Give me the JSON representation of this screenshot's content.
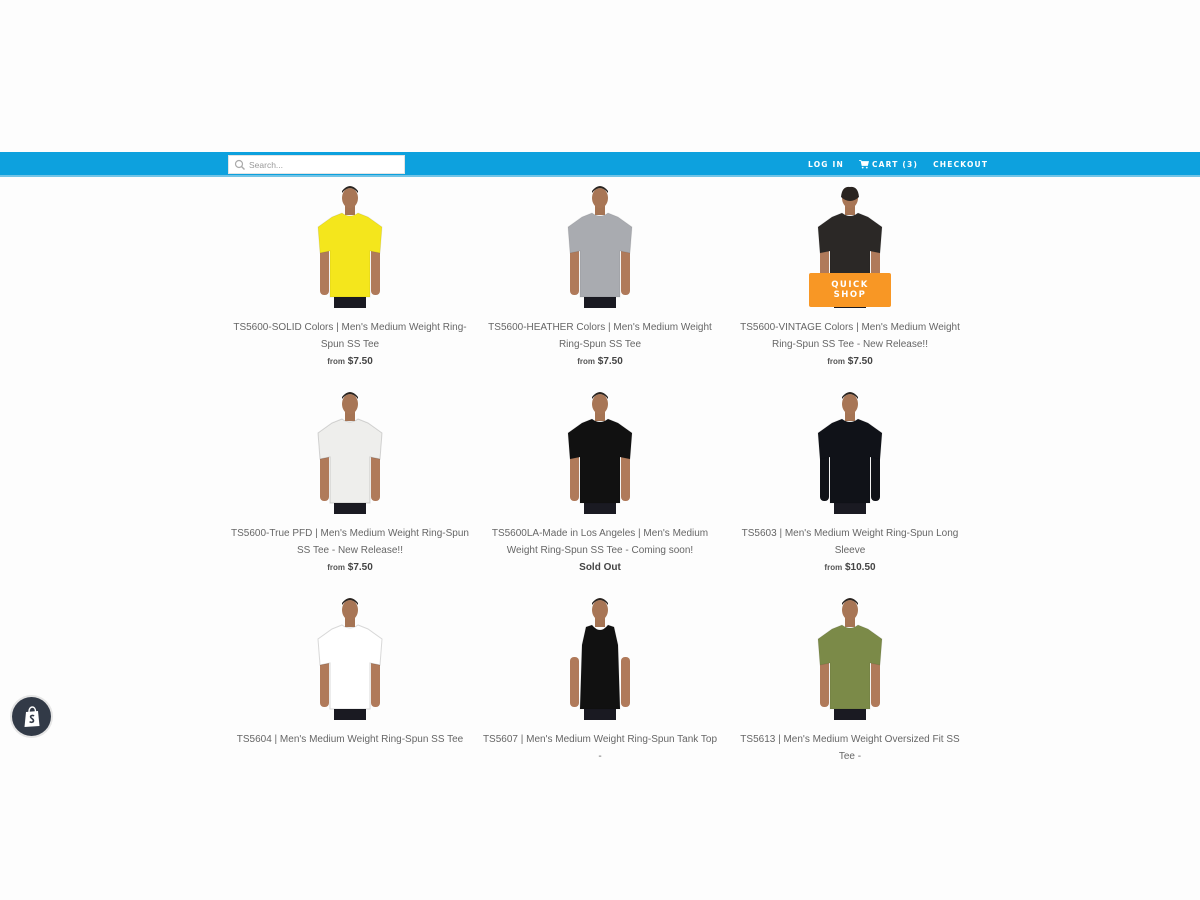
{
  "header": {
    "search": {
      "placeholder": "Search...",
      "value": "",
      "icon": "search-icon"
    },
    "nav": {
      "login_label": "LOG IN",
      "cart_label": "CART (3)",
      "cart_icon": "cart-icon",
      "checkout_label": "CHECKOUT"
    },
    "bar_color": "#0da1de"
  },
  "products": [
    {
      "title": "TS5600-SOLID Colors | Men's Medium Weight Ring-Spun SS Tee",
      "price_prefix": "from",
      "price": "$7.50",
      "shirt_color": "#f4e61c",
      "view": "front"
    },
    {
      "title": "TS5600-HEATHER Colors | Men's Medium Weight Ring-Spun SS Tee",
      "price_prefix": "from",
      "price": "$7.50",
      "shirt_color": "#a9abb0",
      "view": "front"
    },
    {
      "title": "TS5600-VINTAGE Colors | Men's Medium Weight Ring-Spun SS Tee - New Release!!",
      "price_prefix": "from",
      "price": "$7.50",
      "shirt_color": "#2b2826",
      "view": "back",
      "quick_shop": "QUICK SHOP"
    },
    {
      "title": "TS5600-True PFD | Men's Medium Weight Ring-Spun SS Tee - New Release!!",
      "price_prefix": "from",
      "price": "$7.50",
      "shirt_color": "#eeeeec",
      "view": "front"
    },
    {
      "title": "TS5600LA-Made in Los Angeles | Men's Medium Weight Ring-Spun SS Tee - Coming soon!",
      "price_prefix": "",
      "price": "Sold Out",
      "shirt_color": "#111111",
      "view": "front"
    },
    {
      "title": "TS5603 | Men's Medium Weight Ring-Spun Long Sleeve",
      "price_prefix": "from",
      "price": "$10.50",
      "shirt_color": "#101218",
      "view": "front",
      "long_sleeve": true
    },
    {
      "title": "TS5604 | Men's Medium Weight Ring-Spun SS Tee",
      "price_prefix": "",
      "price": "",
      "shirt_color": "#ffffff",
      "view": "front"
    },
    {
      "title": "TS5607 | Men's Medium Weight Ring-Spun Tank Top -",
      "price_prefix": "",
      "price": "",
      "shirt_color": "#111111",
      "view": "front",
      "tank": true
    },
    {
      "title": "TS5613 | Men's Medium Weight Oversized Fit SS Tee -",
      "price_prefix": "",
      "price": "",
      "shirt_color": "#7b8a48",
      "view": "front"
    }
  ],
  "accent_color": "#f89725",
  "badge": {
    "icon": "shopify-bag-icon"
  }
}
